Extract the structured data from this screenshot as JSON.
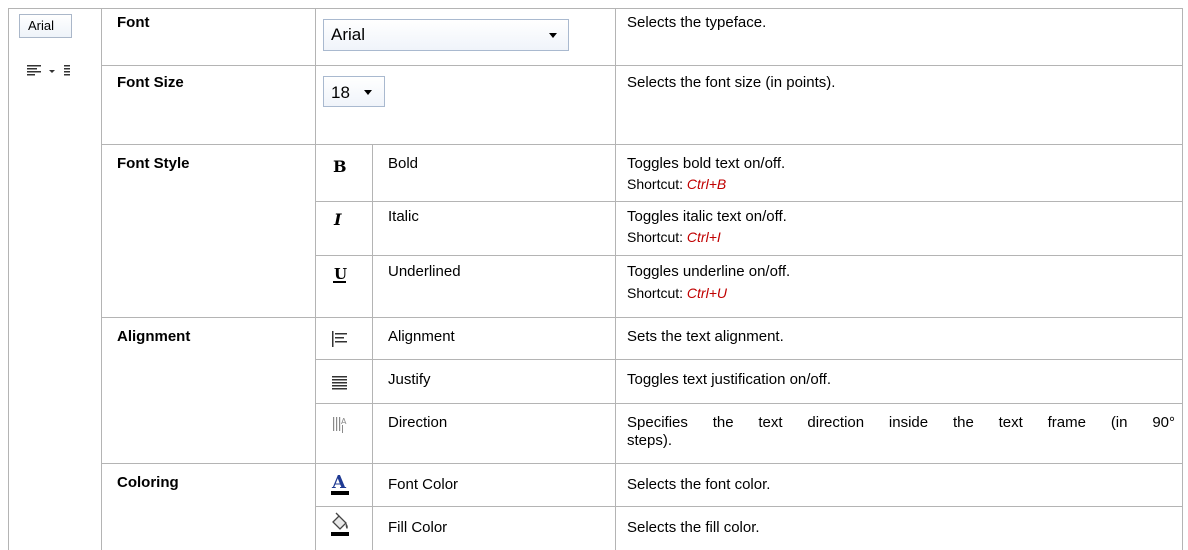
{
  "mini_toolbar": {
    "font_value": "Arial",
    "align_icon": "align-left-icon",
    "dropdown_icon": "chevron-down-icon"
  },
  "rows": {
    "font": {
      "category": "Font",
      "combo_value": "Arial",
      "description": "Selects the typeface."
    },
    "font_size": {
      "category": "Font Size",
      "combo_value": "18",
      "description": "Selects the font size (in points)."
    },
    "font_style": {
      "category": "Font Style",
      "items": [
        {
          "icon": "bold-icon",
          "name": "Bold",
          "description": "Toggles bold text on/off.",
          "shortcut_label": "Shortcut:",
          "shortcut": "Ctrl+B"
        },
        {
          "icon": "italic-icon",
          "name": "Italic",
          "description": "Toggles italic text on/off.",
          "shortcut_label": "Shortcut:",
          "shortcut": "Ctrl+I"
        },
        {
          "icon": "underline-icon",
          "name": "Underlined",
          "description": "Toggles underline on/off.",
          "shortcut_label": "Shortcut:",
          "shortcut": "Ctrl+U"
        }
      ]
    },
    "alignment": {
      "category": "Alignment",
      "items": [
        {
          "icon": "align-left-icon",
          "name": "Alignment",
          "description": "Sets the text alignment."
        },
        {
          "icon": "justify-icon",
          "name": "Justify",
          "description": "Toggles text justification on/off."
        },
        {
          "icon": "text-direction-icon",
          "name": "Direction",
          "description": "Specifies the text direction inside the text frame (in 90°",
          "description_cont": "steps)."
        }
      ]
    },
    "coloring": {
      "category": "Coloring",
      "items": [
        {
          "icon": "font-color-icon",
          "name": "Font Color",
          "description": "Selects the font color."
        },
        {
          "icon": "fill-color-icon",
          "name": "Fill Color",
          "description": "Selects the fill color."
        }
      ]
    }
  },
  "colors": {
    "grid": "#b4b4b4",
    "shortcut": "#c00000",
    "font_color_underline": "#000000"
  }
}
